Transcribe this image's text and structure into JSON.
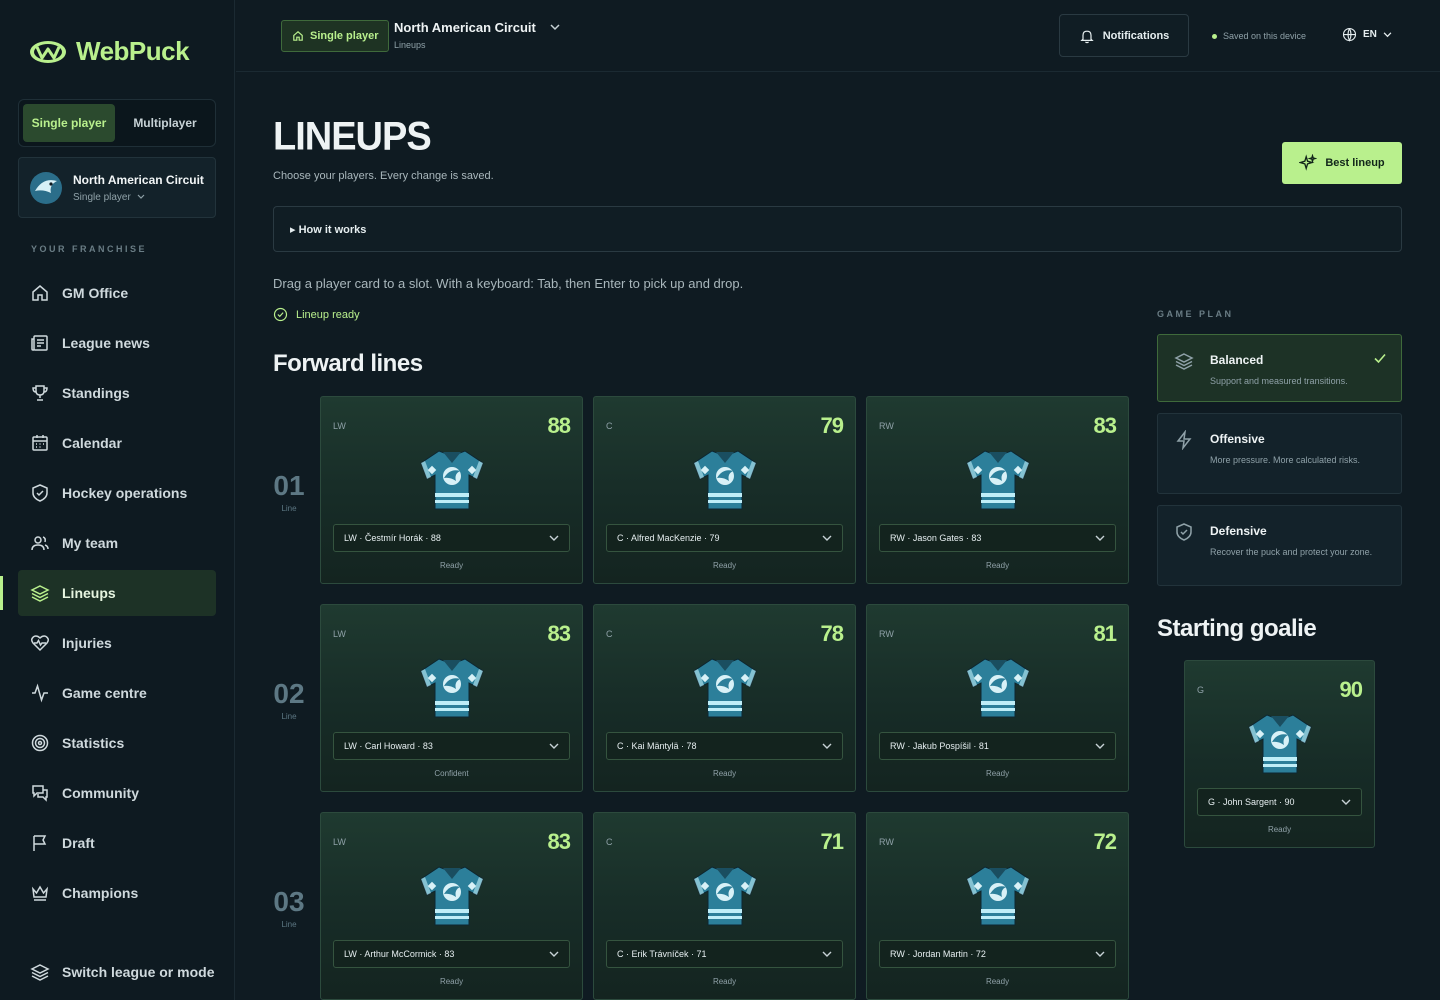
{
  "brand": {
    "name": "WebPuck"
  },
  "sidebar": {
    "modes": [
      "Single player",
      "Multiplayer"
    ],
    "league": {
      "name": "North American Circuit",
      "mode": "Single player"
    },
    "section_label": "YOUR FRANCHISE",
    "items": [
      {
        "label": "GM Office",
        "icon": "home-icon"
      },
      {
        "label": "League news",
        "icon": "news-icon"
      },
      {
        "label": "Standings",
        "icon": "trophy-icon"
      },
      {
        "label": "Calendar",
        "icon": "calendar-icon"
      },
      {
        "label": "Hockey operations",
        "icon": "shield-icon"
      },
      {
        "label": "My team",
        "icon": "users-icon"
      },
      {
        "label": "Lineups",
        "icon": "layers-icon"
      },
      {
        "label": "Injuries",
        "icon": "heart-pulse-icon"
      },
      {
        "label": "Game centre",
        "icon": "activity-icon"
      },
      {
        "label": "Statistics",
        "icon": "target-icon"
      },
      {
        "label": "Community",
        "icon": "chat-icon"
      },
      {
        "label": "Draft",
        "icon": "flag-icon"
      },
      {
        "label": "Champions",
        "icon": "crown-icon"
      }
    ],
    "switch_label": "Switch league or mode"
  },
  "topbar": {
    "chip": "Single player",
    "crumb_title": "North American Circuit",
    "crumb_sub": "Lineups",
    "notifications": "Notifications",
    "saved": "Saved on this device",
    "lang": "EN"
  },
  "page": {
    "title": "LINEUPS",
    "subtitle": "Choose your players. Every change is saved.",
    "best_lineup": "Best lineup",
    "how_it_works": "▸ How it works",
    "drag_hint": "Drag a player card to a slot. With a keyboard: Tab, then Enter to pick up and drop.",
    "status": "Lineup ready",
    "forward_title": "Forward lines",
    "line_word": "Line",
    "lines": [
      {
        "num": "01",
        "players": [
          {
            "pos": "LW",
            "ovr": "88",
            "sel": "LW · Čestmír Horák · 88",
            "status": "Ready"
          },
          {
            "pos": "C",
            "ovr": "79",
            "sel": "C · Alfred MacKenzie · 79",
            "status": "Ready"
          },
          {
            "pos": "RW",
            "ovr": "83",
            "sel": "RW · Jason Gates · 83",
            "status": "Ready"
          }
        ]
      },
      {
        "num": "02",
        "players": [
          {
            "pos": "LW",
            "ovr": "83",
            "sel": "LW · Carl Howard · 83",
            "status": "Confident"
          },
          {
            "pos": "C",
            "ovr": "78",
            "sel": "C · Kai Mäntylä · 78",
            "status": "Ready"
          },
          {
            "pos": "RW",
            "ovr": "81",
            "sel": "RW · Jakub Pospíšil · 81",
            "status": "Ready"
          }
        ]
      },
      {
        "num": "03",
        "players": [
          {
            "pos": "LW",
            "ovr": "83",
            "sel": "LW · Arthur McCormick · 83",
            "status": "Ready"
          },
          {
            "pos": "C",
            "ovr": "71",
            "sel": "C · Erik Trávníček · 71",
            "status": "Ready"
          },
          {
            "pos": "RW",
            "ovr": "72",
            "sel": "RW · Jordan Martin · 72",
            "status": "Ready"
          }
        ]
      }
    ],
    "game_plan_label": "GAME PLAN",
    "game_plans": [
      {
        "title": "Balanced",
        "desc": "Support and measured transitions.",
        "active": true
      },
      {
        "title": "Offensive",
        "desc": "More pressure. More calculated risks.",
        "active": false
      },
      {
        "title": "Defensive",
        "desc": "Recover the puck and protect your zone.",
        "active": false
      }
    ],
    "goalie_title": "Starting goalie",
    "goalie": {
      "pos": "G",
      "ovr": "90",
      "sel": "G · John Sargent · 90",
      "status": "Ready"
    }
  },
  "colors": {
    "accent": "#b9f08d",
    "bg": "#0f1b22",
    "card": "#1f3a30"
  }
}
